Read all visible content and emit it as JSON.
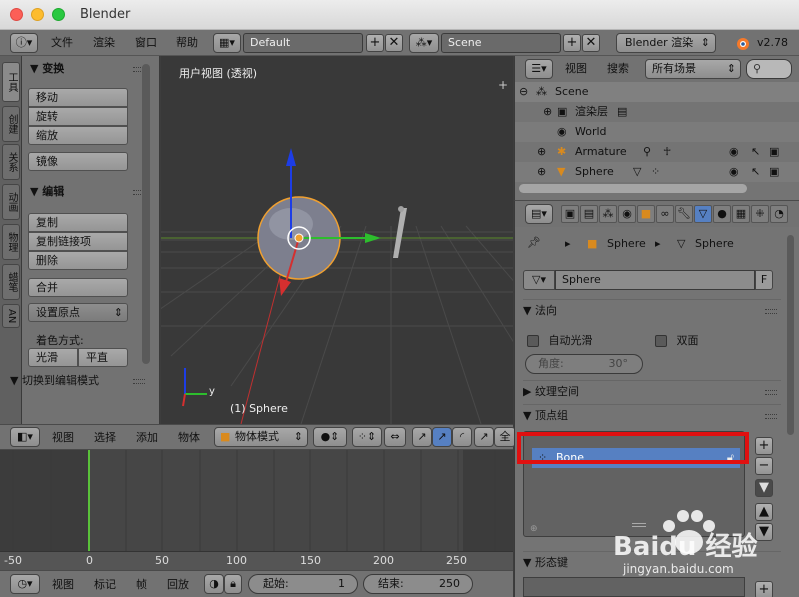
{
  "window": {
    "title": "Blender"
  },
  "infobar": {
    "menus": [
      "文件",
      "渲染",
      "窗口",
      "帮助"
    ],
    "screen_layout": "Default",
    "scene": "Scene",
    "render_engine": "Blender 渲染",
    "version": "v2.78"
  },
  "tool_tabs": [
    "工具",
    "创建",
    "关系",
    "动画",
    "物理",
    "蜡笔",
    "AN"
  ],
  "tool_panel": {
    "transform_header": "变换",
    "transform_buttons": [
      "移动",
      "旋转",
      "缩放"
    ],
    "mirror_button": "镜像",
    "edit_header": "编辑",
    "edit_buttons": [
      "复制",
      "复制链接项",
      "删除"
    ],
    "join_button": "合并",
    "set_origin": "设置原点",
    "shading_label": "着色方式:",
    "smooth_button": "光滑",
    "flat_button": "平直",
    "toggle_edit_mode": "切换到编辑模式"
  },
  "viewport": {
    "label": "用户视图 (透视)",
    "active_object": "(1) Sphere",
    "axis_y": "y",
    "axis_x": "x",
    "axis_z": "z"
  },
  "viewport_header": {
    "menus": [
      "视图",
      "选择",
      "添加",
      "物体"
    ],
    "mode": "物体模式",
    "global": "全局"
  },
  "timeline": {
    "ruler": [
      "-50",
      "0",
      "50",
      "100",
      "150",
      "200",
      "250"
    ],
    "current_frame": 1,
    "menus": [
      "视图",
      "标记",
      "帧",
      "回放"
    ],
    "start_label": "起始:",
    "start_value": "1",
    "end_label": "结束:",
    "end_value": "250"
  },
  "outliner": {
    "menus": [
      "视图",
      "搜索"
    ],
    "filter": "所有场景",
    "rows": [
      {
        "label": "Scene"
      },
      {
        "label": "渲染层"
      },
      {
        "label": "World"
      },
      {
        "label": "Armature"
      },
      {
        "label": "Sphere"
      }
    ]
  },
  "properties": {
    "breadcrumb": [
      "Sphere",
      "Sphere"
    ],
    "mesh_name": "Sphere",
    "fake_user": "F",
    "normals_header": "法向",
    "auto_smooth": "自动光滑",
    "double_sided": "双面",
    "angle_label": "角度:",
    "angle_value": "30°",
    "texture_space": "纹理空间",
    "vertex_groups": "顶点组",
    "vertex_group_items": [
      "Bone"
    ],
    "shape_keys": "形态键"
  },
  "watermark": {
    "text": "Baidu 经验",
    "url": "jingyan.baidu.com"
  },
  "colors": {
    "highlight_box": "#e01010",
    "selected_row": "#5680c2",
    "x_axis": "#d42f2f",
    "y_axis": "#2dbd2d",
    "z_axis": "#1d3de6",
    "selection_orange": "#f0a030"
  }
}
